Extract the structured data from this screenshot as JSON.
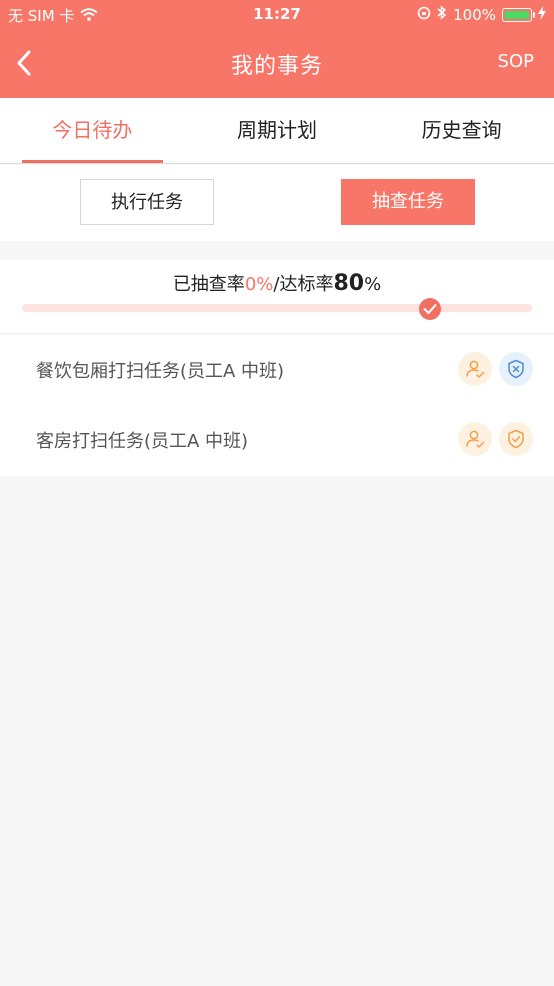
{
  "status_bar": {
    "carrier": "无 SIM 卡",
    "time": "11:27",
    "battery": "100%"
  },
  "nav": {
    "title": "我的事务",
    "right_label": "SOP"
  },
  "tabs": [
    {
      "label": "今日待办",
      "active": true
    },
    {
      "label": "周期计划",
      "active": false
    },
    {
      "label": "历史查询",
      "active": false
    }
  ],
  "sub_buttons": {
    "execute": "执行任务",
    "spot_check": "抽查任务"
  },
  "progress": {
    "label_checked": "已抽查率",
    "checked_rate": "0%",
    "separator": "/",
    "label_target": "达标率",
    "target_value": "80",
    "target_unit": "%",
    "target_fraction": 0.8
  },
  "tasks": [
    {
      "name": "餐饮包厢打扫任务(员工A  中班)",
      "user_icon": "user-check-icon",
      "status_icon": "shield-x-icon"
    },
    {
      "name": "客房打扫任务(员工A  中班)",
      "user_icon": "user-check-icon",
      "status_icon": "shield-check-icon"
    }
  ],
  "colors": {
    "brand": "#f77667",
    "accent_text": "#f27063",
    "user_icon": "#f5a04a",
    "shield_x": "#4a90d9",
    "shield_ok": "#f5a04a"
  }
}
